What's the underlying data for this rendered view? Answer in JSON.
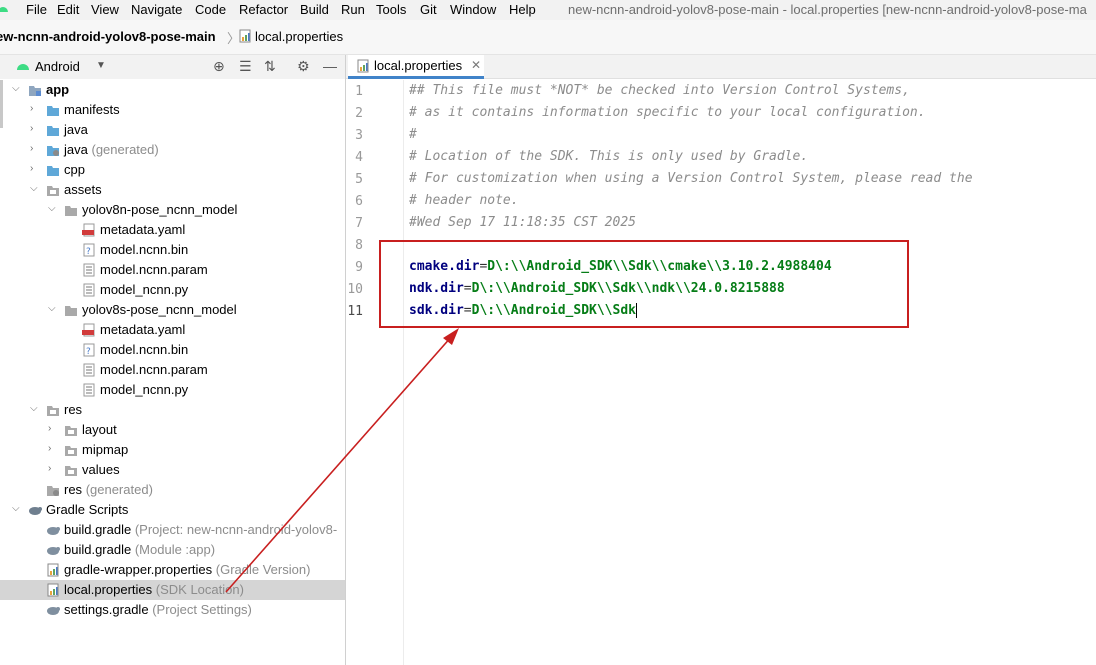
{
  "menu": {
    "items": [
      "File",
      "Edit",
      "View",
      "Navigate",
      "Code",
      "Refactor",
      "Build",
      "Run",
      "Tools",
      "Git",
      "Window",
      "Help"
    ],
    "title": "new-ncnn-android-yolov8-pose-main - local.properties [new-ncnn-android-yolov8-pose-ma"
  },
  "breadcrumb": {
    "project": "ew-ncnn-android-yolov8-pose-main",
    "file": "local.properties"
  },
  "project_panel": {
    "view": "Android",
    "rows": [
      {
        "label": "app",
        "sub": ""
      },
      {
        "label": "manifests",
        "sub": ""
      },
      {
        "label": "java",
        "sub": ""
      },
      {
        "label": "java",
        "sub": "(generated)"
      },
      {
        "label": "cpp",
        "sub": ""
      },
      {
        "label": "assets",
        "sub": ""
      },
      {
        "label": "yolov8n-pose_ncnn_model",
        "sub": ""
      },
      {
        "label": "metadata.yaml",
        "sub": ""
      },
      {
        "label": "model.ncnn.bin",
        "sub": ""
      },
      {
        "label": "model.ncnn.param",
        "sub": ""
      },
      {
        "label": "model_ncnn.py",
        "sub": ""
      },
      {
        "label": "yolov8s-pose_ncnn_model",
        "sub": ""
      },
      {
        "label": "metadata.yaml",
        "sub": ""
      },
      {
        "label": "model.ncnn.bin",
        "sub": ""
      },
      {
        "label": "model.ncnn.param",
        "sub": ""
      },
      {
        "label": "model_ncnn.py",
        "sub": ""
      },
      {
        "label": "res",
        "sub": ""
      },
      {
        "label": "layout",
        "sub": ""
      },
      {
        "label": "mipmap",
        "sub": ""
      },
      {
        "label": "values",
        "sub": ""
      },
      {
        "label": "res",
        "sub": "(generated)"
      },
      {
        "label": "Gradle Scripts",
        "sub": ""
      },
      {
        "label": "build.gradle",
        "sub": "(Project: new-ncnn-android-yolov8-"
      },
      {
        "label": "build.gradle",
        "sub": "(Module :app)"
      },
      {
        "label": "gradle-wrapper.properties",
        "sub": "(Gradle Version)"
      },
      {
        "label": "local.properties",
        "sub": "(SDK Location)"
      },
      {
        "label": "settings.gradle",
        "sub": "(Project Settings)"
      }
    ]
  },
  "editor": {
    "tab_label": "local.properties",
    "line_numbers": [
      "1",
      "2",
      "3",
      "4",
      "5",
      "6",
      "7",
      "8",
      "9",
      "10",
      "11"
    ],
    "comments": [
      "## This file must *NOT* be checked into Version Control Systems,",
      "# as it contains information specific to your local configuration.",
      "#",
      "# Location of the SDK. This is only used by Gradle.",
      "# For customization when using a Version Control System, please read the",
      "# header note.",
      "#Wed Sep 17 11:18:35 CST 2025"
    ],
    "properties": [
      {
        "key": "cmake.dir",
        "eq": "=",
        "value": "D\\:\\\\Android_SDK\\\\Sdk\\\\cmake\\\\3.10.2.4988404"
      },
      {
        "key": "ndk.dir",
        "eq": "=",
        "value": "D\\:\\\\Android_SDK\\\\Sdk\\\\ndk\\\\24.0.8215888"
      },
      {
        "key": "sdk.dir",
        "eq": "=",
        "value": "D\\:\\\\Android_SDK\\\\Sdk"
      }
    ]
  },
  "colors": {
    "annotation_red": "#c81f1f",
    "selection_gray": "#d5d5d5",
    "tab_accent": "#4083c9"
  }
}
